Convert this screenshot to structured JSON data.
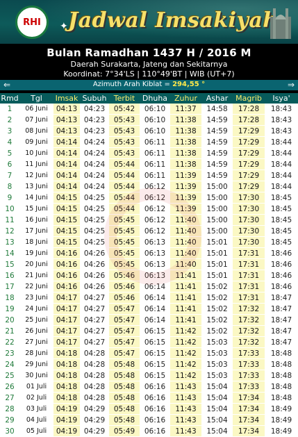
{
  "banner": {
    "logo_text": "RHI",
    "title": "Jadwal Imsakiyah"
  },
  "header": {
    "title": "Bulan Ramadhan 1437 H / 2016 M",
    "region": "Daerah Surakarta, Jateng dan Sekitarnya",
    "coordinates": "Koordinat: 7°34'LS | 110°49'BT | WIB (UT+7)"
  },
  "kiblat": {
    "label": "Azimuth Arah Kiblat = ",
    "value": "294,55 °"
  },
  "colors": {
    "header_bg": "#075b5b",
    "highlight_col": "#fbf8c4",
    "title_yellow": "#f6e06a"
  },
  "table": {
    "columns": [
      "Rmd",
      "Tgl",
      "Imsak",
      "Subuh",
      "Terbit",
      "Dhuha",
      "Zuhur",
      "Ashar",
      "Magrib",
      "Isya'"
    ],
    "rows": [
      [
        "1",
        "06 Juni",
        "04:13",
        "04:23",
        "05:42",
        "06:10",
        "11:37",
        "14:58",
        "17:28",
        "18:43"
      ],
      [
        "2",
        "07 Juni",
        "04:13",
        "04:23",
        "05:43",
        "06:10",
        "11:38",
        "14:59",
        "17:28",
        "18:43"
      ],
      [
        "3",
        "08 Juni",
        "04:13",
        "04:23",
        "05:43",
        "06:10",
        "11:38",
        "14:59",
        "17:29",
        "18:43"
      ],
      [
        "4",
        "09 Juni",
        "04:14",
        "04:24",
        "05:43",
        "06:11",
        "11:38",
        "14:59",
        "17:29",
        "18:44"
      ],
      [
        "5",
        "10 Juni",
        "04:14",
        "04:24",
        "05:43",
        "06:11",
        "11:38",
        "14:59",
        "17:29",
        "18:44"
      ],
      [
        "6",
        "11 Juni",
        "04:14",
        "04:24",
        "05:44",
        "06:11",
        "11:38",
        "14:59",
        "17:29",
        "18:44"
      ],
      [
        "7",
        "12 Juni",
        "04:14",
        "04:24",
        "05:44",
        "06:11",
        "11:39",
        "14:59",
        "17:29",
        "18:44"
      ],
      [
        "8",
        "13 Juni",
        "04:14",
        "04:24",
        "05:44",
        "06:12",
        "11:39",
        "15:00",
        "17:29",
        "18:44"
      ],
      [
        "9",
        "14 Juni",
        "04:15",
        "04:25",
        "05:44",
        "06:12",
        "11:39",
        "15:00",
        "17:30",
        "18:45"
      ],
      [
        "10",
        "15 Juni",
        "04:15",
        "04:25",
        "05:44",
        "06:12",
        "11:39",
        "15:00",
        "17:30",
        "18:45"
      ],
      [
        "11",
        "16 Juni",
        "04:15",
        "04:25",
        "05:45",
        "06:12",
        "11:40",
        "15:00",
        "17:30",
        "18:45"
      ],
      [
        "12",
        "17 Juni",
        "04:15",
        "04:25",
        "05:45",
        "06:12",
        "11:40",
        "15:00",
        "17:30",
        "18:45"
      ],
      [
        "13",
        "18 Juni",
        "04:15",
        "04:25",
        "05:45",
        "06:13",
        "11:40",
        "15:01",
        "17:30",
        "18:45"
      ],
      [
        "14",
        "19 Juni",
        "04:16",
        "04:26",
        "05:45",
        "06:13",
        "11:40",
        "15:01",
        "17:31",
        "18:46"
      ],
      [
        "15",
        "20 Juni",
        "04:16",
        "04:26",
        "05:45",
        "06:13",
        "11:40",
        "15:01",
        "17:31",
        "18:46"
      ],
      [
        "16",
        "21 Juni",
        "04:16",
        "04:26",
        "05:46",
        "06:13",
        "11:41",
        "15:01",
        "17:31",
        "18:46"
      ],
      [
        "17",
        "22 Juni",
        "04:16",
        "04:26",
        "05:46",
        "06:14",
        "11:41",
        "15:02",
        "17:31",
        "18:46"
      ],
      [
        "18",
        "23 Juni",
        "04:17",
        "04:27",
        "05:46",
        "06:14",
        "11:41",
        "15:02",
        "17:31",
        "18:47"
      ],
      [
        "19",
        "24 Juni",
        "04:17",
        "04:27",
        "05:47",
        "06:14",
        "11:41",
        "15:02",
        "17:32",
        "18:47"
      ],
      [
        "20",
        "25 Juni",
        "04:17",
        "04:27",
        "05:47",
        "06:14",
        "11:41",
        "15:02",
        "17:32",
        "18:47"
      ],
      [
        "21",
        "26 Juni",
        "04:17",
        "04:27",
        "05:47",
        "06:15",
        "11:42",
        "15:02",
        "17:32",
        "18:47"
      ],
      [
        "22",
        "27 Juni",
        "04:17",
        "04:27",
        "05:47",
        "06:15",
        "11:42",
        "15:03",
        "17:32",
        "18:47"
      ],
      [
        "23",
        "28 Juni",
        "04:18",
        "04:28",
        "05:47",
        "06:15",
        "11:42",
        "15:03",
        "17:33",
        "18:48"
      ],
      [
        "24",
        "29 Juni",
        "04:18",
        "04:28",
        "05:48",
        "06:15",
        "11:42",
        "15:03",
        "17:33",
        "18:48"
      ],
      [
        "25",
        "30 Juni",
        "04:18",
        "04:28",
        "05:48",
        "06:15",
        "11:42",
        "15:03",
        "17:33",
        "18:48"
      ],
      [
        "26",
        "01 Juli",
        "04:18",
        "04:28",
        "05:48",
        "06:16",
        "11:43",
        "15:04",
        "17:33",
        "18:48"
      ],
      [
        "27",
        "02 Juli",
        "04:18",
        "04:28",
        "05:48",
        "06:16",
        "11:43",
        "15:04",
        "17:34",
        "18:48"
      ],
      [
        "28",
        "03 Juli",
        "04:19",
        "04:29",
        "05:48",
        "06:16",
        "11:43",
        "15:04",
        "17:34",
        "18:49"
      ],
      [
        "29",
        "04 Juli",
        "04:19",
        "04:29",
        "05:48",
        "06:16",
        "11:43",
        "15:04",
        "17:34",
        "18:49"
      ],
      [
        "30",
        "05 Juli",
        "04:19",
        "04:29",
        "05:49",
        "06:16",
        "11:43",
        "15:04",
        "17:34",
        "18:49"
      ]
    ]
  }
}
